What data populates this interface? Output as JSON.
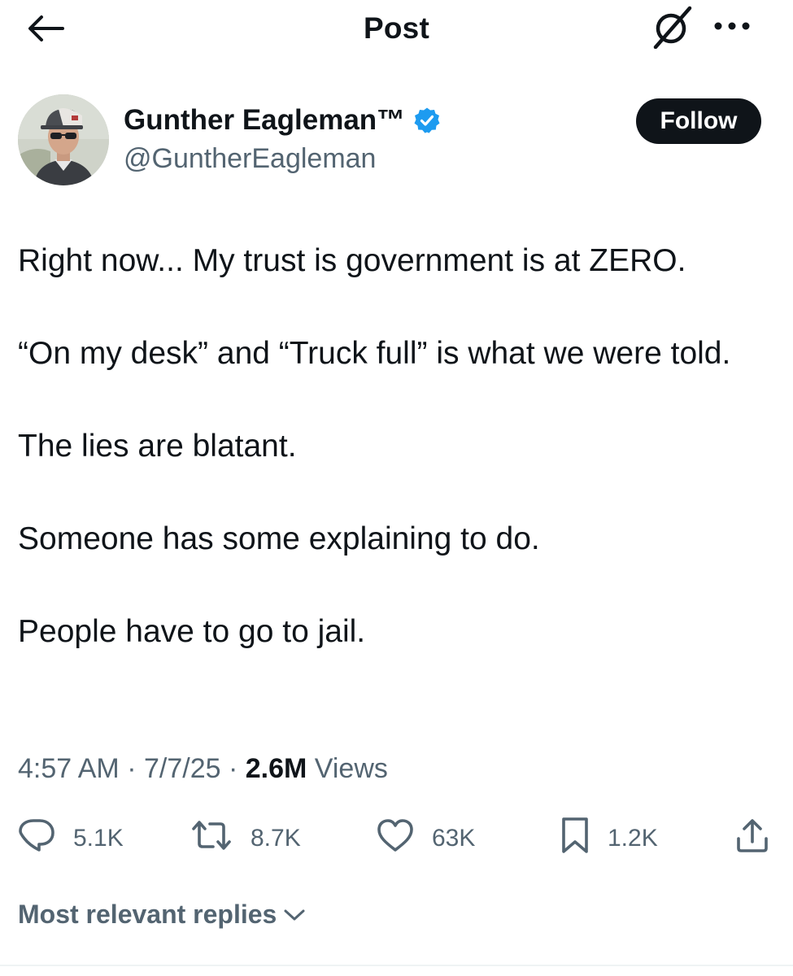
{
  "header": {
    "title": "Post",
    "icons": {
      "back": "arrow-left-icon",
      "grok": "grok-icon",
      "more": "more-horizontal-icon"
    }
  },
  "author": {
    "name": "Gunther Eagleman™",
    "handle": "@GuntherEagleman",
    "verified": true,
    "follow_label": "Follow",
    "badge_color": "#1d9bf0"
  },
  "post": {
    "paragraphs": [
      "Right now... My trust is government is at ZERO.",
      "“On my desk” and “Truck full” is what we were told.",
      "The lies are blatant.",
      "Someone has some explaining to do.",
      "People have to go to jail."
    ],
    "time": "4:57 AM",
    "date": "7/7/25",
    "separator": "·",
    "views_count": "2.6M",
    "views_label": "Views"
  },
  "actions": {
    "replies": "5.1K",
    "reposts": "8.7K",
    "likes": "63K",
    "bookmarks": "1.2K"
  },
  "replies_sort": {
    "label": "Most relevant replies"
  },
  "colors": {
    "text": "#0f1419",
    "secondary": "#536471",
    "accent": "#1d9bf0",
    "background": "#ffffff"
  }
}
